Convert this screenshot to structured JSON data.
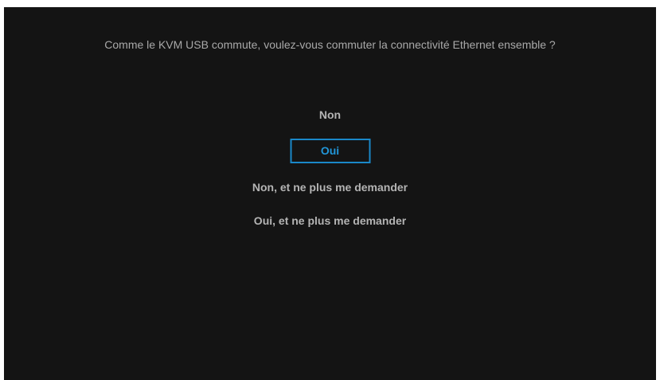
{
  "dialog": {
    "question": "Comme le KVM USB commute, voulez-vous commuter la connectivité Ethernet ensemble ?",
    "options": [
      {
        "label": "Non",
        "selected": false
      },
      {
        "label": "Oui",
        "selected": true
      },
      {
        "label": "Non, et ne plus me demander",
        "selected": false
      },
      {
        "label": "Oui, et ne plus me demander",
        "selected": false
      }
    ]
  },
  "colors": {
    "background": "#141414",
    "text": "#b4b4b4",
    "selected_accent": "#1a88c9"
  }
}
